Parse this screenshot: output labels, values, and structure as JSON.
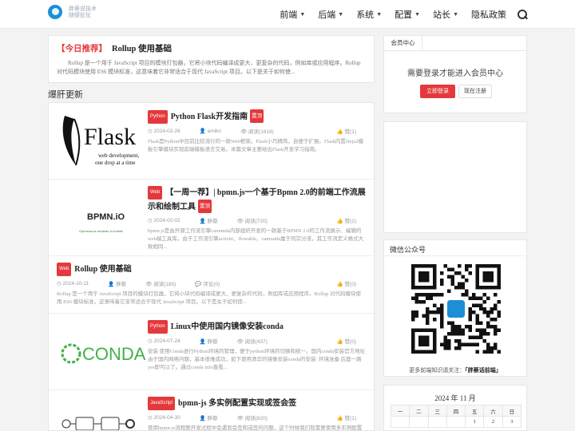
{
  "site": {
    "logo_line1": "胖蔡说技术",
    "logo_line2": "随便扯扯"
  },
  "nav": {
    "items": [
      {
        "label": "前端",
        "dropdown": true
      },
      {
        "label": "后端",
        "dropdown": true
      },
      {
        "label": "系统",
        "dropdown": true
      },
      {
        "label": "配置",
        "dropdown": true
      },
      {
        "label": "站长",
        "dropdown": true
      },
      {
        "label": "隐私政策",
        "dropdown": false
      }
    ],
    "search_icon": "search-icon"
  },
  "featured": {
    "tag": "【今日推荐】",
    "title": "Rollup 使用基础",
    "excerpt": "Rollup 是一个用于 JavaScript 项目的模块打包器，它将小块代码编译成更大、更复杂的代码，例如库或应用程序。Rollup 对代码模块使用 ES6 模块标准，这意味着它非常适合于现代 JavaScript 项目。以下是关于如何使..."
  },
  "section_title": "爆肝更新",
  "articles": [
    {
      "category": "Python",
      "title": "Python Flask开发指南",
      "hot": "置顶",
      "date": "2024-02-26",
      "author": "amiko",
      "views": "阅读(1619)",
      "likes": "赞(1)",
      "excerpt": "Flask是Python中目前比较流行的一款Web框架。Flask小巧精简，自便于扩展。Flask内置Jinja2模板引擎模块实现前端模板语言交易。本篇文章主要给出Flask开发学习指南。",
      "thumb": {
        "logo": "Flask",
        "line1": "web development,",
        "line2": "one drop at a time"
      }
    },
    {
      "category": "Web",
      "title": "【一周一荐】| bpmn.js一个基于Bpmn 2.0的前端工作流展示和绘制工具",
      "hot": "置顶",
      "date": "2024-02-02",
      "author": "胖蔡",
      "views": "阅读(720)",
      "likes": "赞(2)",
      "excerpt": "bpmn.js是由开源工作流引擎camunda内部组织开发的一款基于BPMN 2.0的工作流展示、编辑的web端工具库。由于工作流引擎activiti、flowable、camunda属于同宗分流，其工作流定义格式大致相同...",
      "thumb": {
        "logo": "BPMN.iO",
        "line1": "Opensource modeler & toolkits",
        "line2": ""
      }
    },
    {
      "category": "Web",
      "title": "Rollup 使用基础",
      "hot": "",
      "date": "2024-10-11",
      "author": "胖蔡",
      "views": "阅读(180)",
      "comments": "评论(0)",
      "likes": "赞(0)",
      "excerpt": "Rollup 是一个用于 JavaScript 项目的模块打包器，它将小块代码编译成更大、更复杂的代码，例如库或应用程序。Rollup 对代码模块使用 ES6 模块标准，这意味着它非常适合于现代 JavaScript 项目。以下是关于如何使..."
    },
    {
      "category": "Python",
      "title": "Linux中使用国内镜像安装conda",
      "hot": "",
      "date": "2024-07-24",
      "author": "胖蔡",
      "views": "阅读(437)",
      "likes": "赞(0)",
      "excerpt": "安装 使用Conda进行Python环境的管理，便于python环境的切换和统一。国内conda安装官方地址由于国内网络问题，基本很难成功，如下使用清华的镜像安装conda的安装: 环境准备 后面一路yes即可以了。通过conda info查看...",
      "thumb": {
        "logo": "CONDA"
      }
    },
    {
      "category": "JavaScript",
      "title": "bpmn-js 多实例配置实现或签会签",
      "hot": "",
      "date": "2024-04-30",
      "author": "胖蔡",
      "views": "阅读(820)",
      "likes": "赞(1)",
      "excerpt": "使用bpmn-js流程图开发过程中会遇到会签和或签的问题，这个时候我们就需要使用多实例配置来实现"
    }
  ],
  "member": {
    "tab": "会员中心",
    "message": "需要登录才能进入会员中心",
    "login": "立即登录",
    "register": "现在注册"
  },
  "wechat": {
    "title": "微信公众号",
    "caption_prefix": "更多前端知识请关注：",
    "caption_name": "「胖蔡话前端」"
  },
  "calendar": {
    "title": "2024 年 11 月",
    "weekdays": [
      "一",
      "二",
      "三",
      "四",
      "五",
      "六",
      "日"
    ],
    "rows": [
      [
        "",
        "",
        "",
        "",
        "1",
        "2",
        "3"
      ]
    ]
  },
  "colors": {
    "accent": "#e4393c",
    "link": "#1c8fd6"
  }
}
